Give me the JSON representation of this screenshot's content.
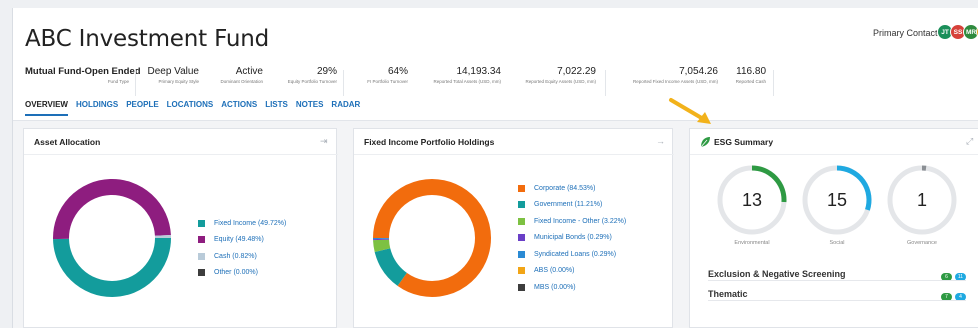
{
  "header": {
    "title": "ABC Investment Fund",
    "contacts_label": "Primary Contacts",
    "avatars": [
      {
        "initials": "JT",
        "color": "#1b8f5a"
      },
      {
        "initials": "SS",
        "color": "#d6413a"
      },
      {
        "initials": "MR",
        "color": "#2f8a3e"
      },
      {
        "initials": "",
        "color": "#e8a722"
      }
    ]
  },
  "metrics": [
    {
      "value": "Mutual Fund-Open Ended",
      "label": "Fund Type"
    },
    {
      "value": "Deep Value",
      "label": "Primary Equity Style"
    },
    {
      "value": "Active",
      "label": "Dominant Orientation"
    },
    {
      "value": "29%",
      "label": "Equity Portfolio Turnover"
    },
    {
      "value": "64%",
      "label": "FI Portfolio Turnover"
    },
    {
      "value": "14,193.34",
      "label": "Reported Total Assets (USD, mm)"
    },
    {
      "value": "7,022.29",
      "label": "Reported Equity Assets (USD, mm)"
    },
    {
      "value": "7,054.26",
      "label": "Reported Fixed Income Assets (USD, mm)"
    },
    {
      "value": "116.80",
      "label": "Reported Cash"
    }
  ],
  "tabs": [
    "OVERVIEW",
    "HOLDINGS",
    "PEOPLE",
    "LOCATIONS",
    "ACTIONS",
    "LISTS",
    "NOTES",
    "RADAR"
  ],
  "asset_allocation": {
    "title": "Asset Allocation",
    "items": [
      {
        "label": "Fixed Income (49.72%)",
        "value": 49.72,
        "color": "#139c9c"
      },
      {
        "label": "Equity (49.48%)",
        "value": 49.48,
        "color": "#8e1d7f"
      },
      {
        "label": "Cash (0.82%)",
        "value": 0.82,
        "color": "#b9cbd9"
      },
      {
        "label": "Other (0.00%)",
        "value": 0.0,
        "color": "#3d3d3d"
      }
    ]
  },
  "fixed_income": {
    "title": "Fixed Income Portfolio Holdings",
    "items": [
      {
        "label": "Corporate (84.53%)",
        "value": 84.53,
        "color": "#f26c0d"
      },
      {
        "label": "Government (11.21%)",
        "value": 11.21,
        "color": "#139c9c"
      },
      {
        "label": "Fixed Income - Other (3.22%)",
        "value": 3.22,
        "color": "#7dc142"
      },
      {
        "label": "Municipal Bonds (0.29%)",
        "value": 0.29,
        "color": "#6a3fc7"
      },
      {
        "label": "Syndicated Loans (0.29%)",
        "value": 0.29,
        "color": "#2a8ad4"
      },
      {
        "label": "ABS (0.00%)",
        "value": 0.0,
        "color": "#f2a516"
      },
      {
        "label": "MBS (0.00%)",
        "value": 0.0,
        "color": "#3d3d3d"
      }
    ]
  },
  "esg": {
    "title": "ESG Summary",
    "scores": [
      {
        "value": "13",
        "label": "Environmental",
        "fraction": 0.26,
        "color": "#2e9a43"
      },
      {
        "value": "15",
        "label": "Social",
        "fraction": 0.3,
        "color": "#1fa9e1"
      },
      {
        "value": "1",
        "label": "Governance",
        "fraction": 0.02,
        "color": "#8b8f94"
      }
    ],
    "rows": [
      {
        "label": "Exclusion & Negative Screening",
        "badges": [
          {
            "text": "6",
            "color": "#2e9a43"
          },
          {
            "text": "11",
            "color": "#1fa9e1"
          }
        ]
      },
      {
        "label": "Thematic",
        "badges": [
          {
            "text": "7",
            "color": "#2e9a43"
          },
          {
            "text": "4",
            "color": "#1fa9e1"
          }
        ]
      }
    ]
  },
  "annotation": {
    "arrow_color": "#f2b21b"
  }
}
